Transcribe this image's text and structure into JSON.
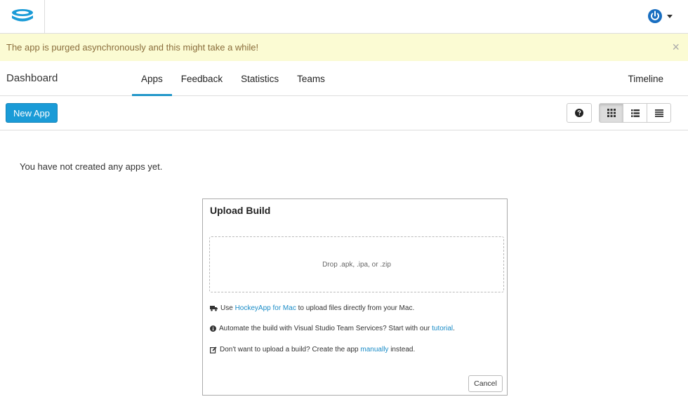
{
  "header": {
    "logo_icon": "hockeyapp-logo-icon",
    "user_icon": "power-icon",
    "accent_color": "#1a9bd7"
  },
  "alert": {
    "message": "The app is purged asynchronously and this might take a while!",
    "close_label": "×"
  },
  "subnav": {
    "title": "Dashboard",
    "tabs": [
      {
        "label": "Apps",
        "active": true
      },
      {
        "label": "Feedback",
        "active": false
      },
      {
        "label": "Statistics",
        "active": false
      },
      {
        "label": "Teams",
        "active": false
      }
    ],
    "timeline_label": "Timeline"
  },
  "toolbar": {
    "new_app_label": "New App",
    "help_icon": "question-circle-icon",
    "view_icons": [
      "grid-view-icon",
      "list-view-icon",
      "compact-list-icon"
    ]
  },
  "main": {
    "empty_message": "You have not created any apps yet."
  },
  "upload_modal": {
    "title": "Upload Build",
    "dropzone_text": "Drop .apk, .ipa, or .zip",
    "line1": {
      "prefix": "Use ",
      "link": "HockeyApp for Mac",
      "suffix": " to upload files directly from your Mac."
    },
    "line2": {
      "prefix": "Automate the build with Visual Studio Team Services? Start with our ",
      "link": "tutorial",
      "suffix": "."
    },
    "line3": {
      "prefix": "Don't want to upload a build? Create the app ",
      "link": "manually",
      "suffix": " instead."
    },
    "cancel_label": "Cancel"
  }
}
